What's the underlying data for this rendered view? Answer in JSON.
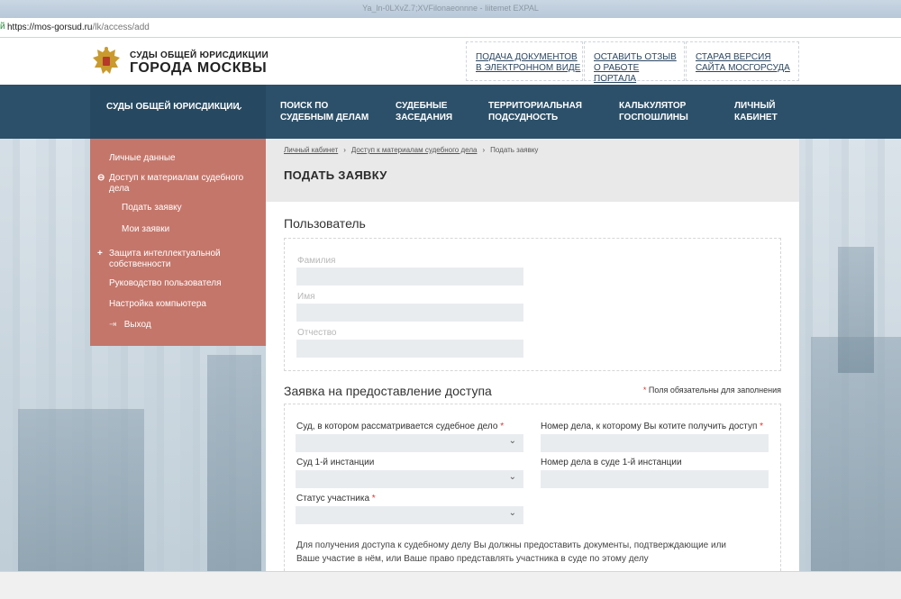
{
  "browser": {
    "window_title": "Ya_ln-0LXvZ.7;XVFilonaeonnne - Iiitemet EXPAL",
    "url_host": "https://mos-gorsud.ru",
    "url_path": "/lk/access/add"
  },
  "logo": {
    "line1": "СУДЫ ОБЩЕЙ ЮРИСДИКЦИИ",
    "line2": "ГОРОДА МОСКВЫ"
  },
  "header_links": [
    {
      "line1": "ПОДАЧА ДОКУМЕНТОВ",
      "line2": "В ЭЛЕКТРОННОМ ВИДЕ"
    },
    {
      "line1": "ОСТАВИТЬ ОТЗЫВ",
      "line2": "О РАБОТЕ ПОРТАЛА"
    },
    {
      "line1": "СТАРАЯ ВЕРСИЯ",
      "line2": "САЙТА МОСГОРСУДА"
    }
  ],
  "nav": {
    "courts": "СУДЫ ОБЩЕЙ ЮРИСДИКЦИИ",
    "items": [
      {
        "line1": "ПОИСК ПО",
        "line2": "СУДЕБНЫМ ДЕЛАМ"
      },
      {
        "line1": "СУДЕБНЫЕ",
        "line2": "ЗАСЕДАНИЯ"
      },
      {
        "line1": "ТЕРРИТОРИАЛЬНАЯ",
        "line2": "ПОДСУДНОСТЬ"
      },
      {
        "line1": "КАЛЬКУЛЯТОР",
        "line2": "ГОСПОШЛИНЫ"
      },
      {
        "line1": "ЛИЧНЫЙ",
        "line2": "КАБИНЕТ"
      }
    ]
  },
  "sidebar": {
    "personal": "Личные данные",
    "access": "Доступ к материалам судебного дела",
    "submit": "Подать заявку",
    "my_requests": "Мои заявки",
    "ip": "Защита интеллектуальной собственности",
    "guide": "Руководство пользователя",
    "setup": "Настройка компьютера",
    "exit": "Выход",
    "access_marker": "⊖",
    "ip_marker": "+"
  },
  "breadcrumbs": {
    "home": "Личный кабинет",
    "access": "Доступ к материалам судебного дела",
    "current": "Подать заявку"
  },
  "page_title": "ПОДАТЬ ЗАЯВКУ",
  "user_section": {
    "title": "Пользователь",
    "surname": "Фамилия",
    "name": "Имя",
    "patronymic": "Отчество"
  },
  "request_section": {
    "title": "Заявка на предоставление доступа",
    "required_note": "Поля обязательны для заполнения",
    "court_label": "Суд, в котором рассматривается судебное дело",
    "case_number_label": "Номер дела, к которому Вы котите получить доступ",
    "first_instance_label": "Суд 1-й инстанции",
    "first_instance_number_label": "Номер дела в суде 1-й инстанции",
    "status_label": "Статус участника",
    "info_text": "Для получения доступа к судебному делу Вы должны предоставить документы, подтверждающие или Ваше участие в нём, или Ваше право представлять участника в суде по этому делу"
  },
  "colors": {
    "nav_bg": "#2c5069",
    "sidebar_bg": "#c4766a",
    "required_star": "#dd3333"
  }
}
